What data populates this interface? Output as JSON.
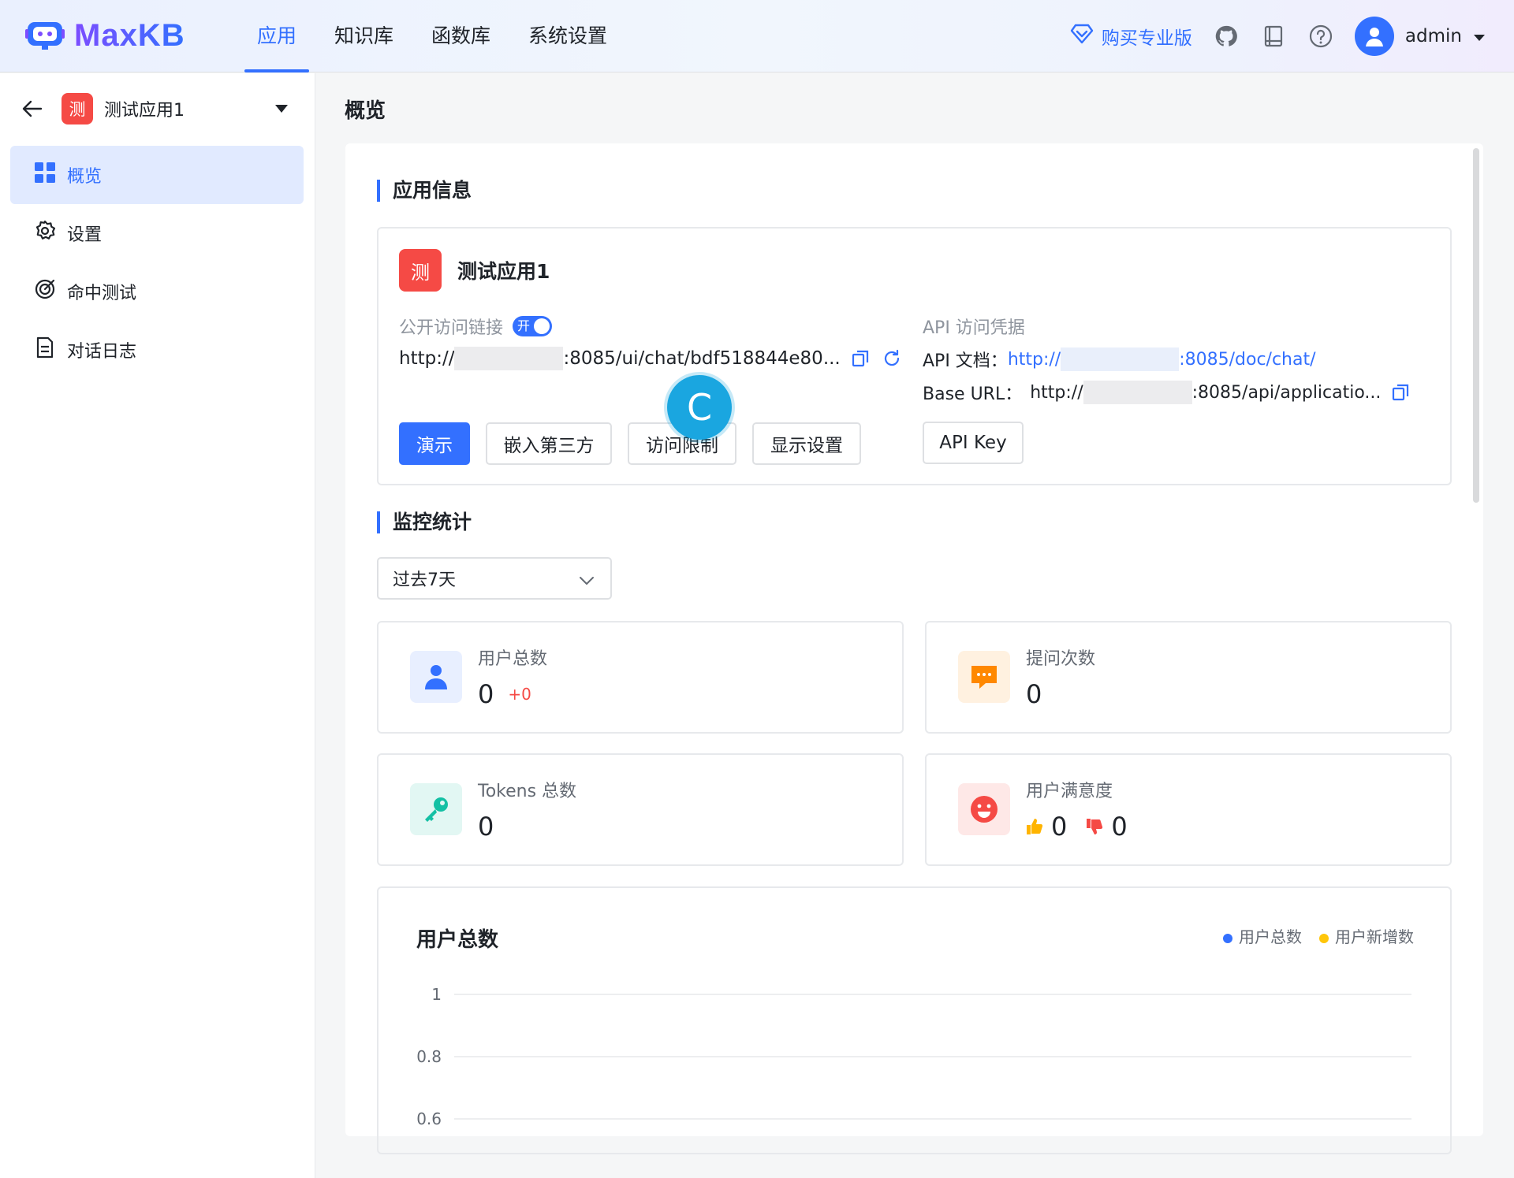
{
  "header": {
    "logo_text": "MaxKB",
    "nav": [
      {
        "label": "应用",
        "active": true
      },
      {
        "label": "知识库"
      },
      {
        "label": "函数库"
      },
      {
        "label": "系统设置"
      }
    ],
    "buy_pro": "购买专业版",
    "user": "admin",
    "accent_color": "#3370ff"
  },
  "sidebar": {
    "app_badge": "测",
    "app_name": "测试应用1",
    "items": [
      {
        "label": "概览",
        "icon": "grid-icon",
        "active": true
      },
      {
        "label": "设置",
        "icon": "gear-icon"
      },
      {
        "label": "命中测试",
        "icon": "target-icon"
      },
      {
        "label": "对话日志",
        "icon": "document-icon"
      }
    ]
  },
  "page": {
    "title": "概览",
    "app_info_title": "应用信息",
    "monitor_title": "监控统计"
  },
  "app_info": {
    "badge": "测",
    "name": "测试应用1",
    "public_link_label": "公开访问链接",
    "toggle_text": "开",
    "url_prefix": "http://",
    "url_suffix": ":8085/ui/chat/bdf518844e80...",
    "api_title": "API 访问凭据",
    "api_doc_label": "API 文档：",
    "api_doc_prefix": "http://",
    "api_doc_suffix": ":8085/doc/chat/",
    "base_url_label": "Base URL：",
    "base_url_prefix": "http://",
    "base_url_suffix": ":8085/api/applicatio...",
    "buttons": {
      "demo": "演示",
      "embed": "嵌入第三方",
      "access": "访问限制",
      "display": "显示设置",
      "api_key": "API Key"
    },
    "loading_glyph": "C"
  },
  "monitor": {
    "range": "过去7天",
    "stats": [
      {
        "label": "用户总数",
        "value": "0",
        "delta": "+0",
        "icon": "user-icon",
        "color": "#3370ff"
      },
      {
        "label": "提问次数",
        "value": "0",
        "icon": "chat-icon",
        "color": "#ff8800"
      },
      {
        "label": "Tokens 总数",
        "value": "0",
        "icon": "key-icon",
        "color": "#14c0a4"
      },
      {
        "label": "用户满意度",
        "like": "0",
        "dislike": "0",
        "icon": "smile-icon",
        "color": "#f54a45"
      }
    ]
  },
  "chart_data": {
    "type": "line",
    "title": "用户总数",
    "series": [
      {
        "name": "用户总数",
        "color": "#3370ff",
        "values": []
      },
      {
        "name": "用户新增数",
        "color": "#ffc60a",
        "values": []
      }
    ],
    "y_ticks": [
      "1",
      "0.8",
      "0.6"
    ],
    "ylim": [
      0,
      1
    ],
    "legend": "top-right",
    "grid": true
  }
}
